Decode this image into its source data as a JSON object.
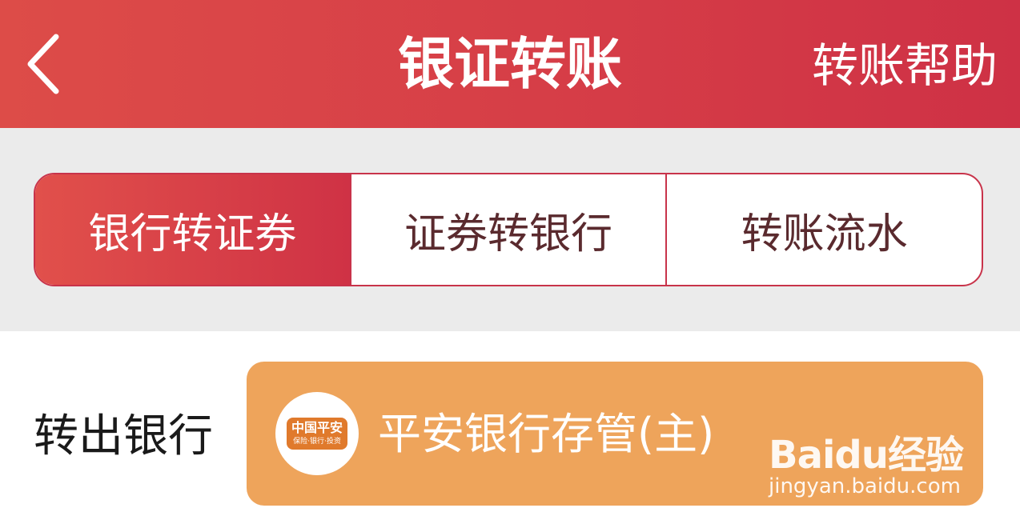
{
  "header": {
    "title": "银证转账",
    "help_label": "转账帮助",
    "back_icon": "chevron-left-icon",
    "bg_color": "#d63f47"
  },
  "tabs": [
    {
      "label": "银行转证券",
      "active": true
    },
    {
      "label": "证券转银行",
      "active": false
    },
    {
      "label": "转账流水",
      "active": false
    }
  ],
  "form": {
    "out_bank_label": "转出银行",
    "out_bank_value": "平安银行存管(主)",
    "bank_logo": {
      "icon": "ping-an-bank-logo",
      "text": "中国平安",
      "subtext": "保险·银行·投资"
    },
    "field_color": "#eea45b"
  },
  "watermark": {
    "brand": "Baidu经验",
    "url": "jingyan.baidu.com"
  },
  "colors": {
    "accent": "#d63f47",
    "band": "#ebebeb"
  }
}
